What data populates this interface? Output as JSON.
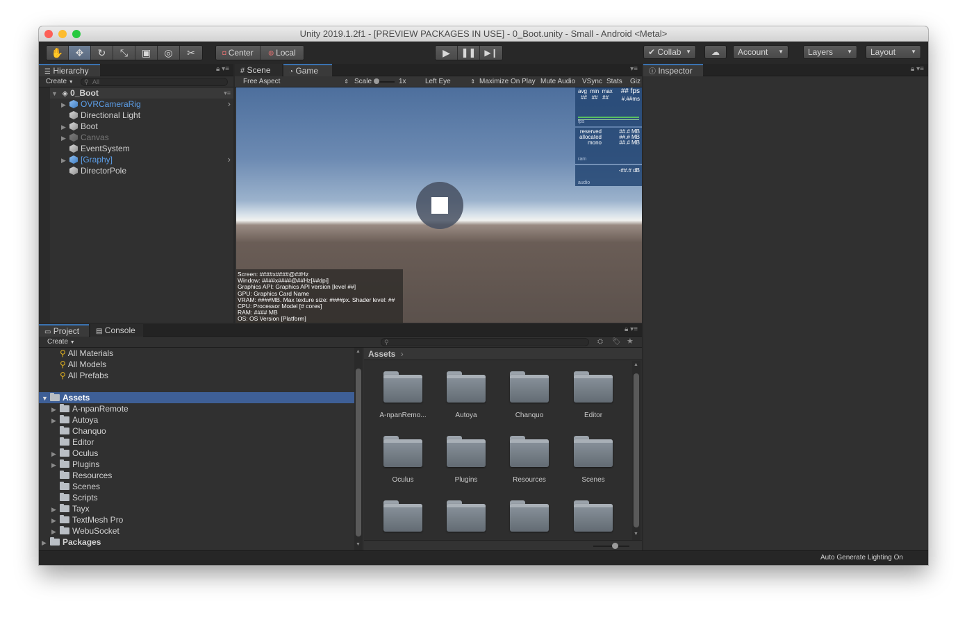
{
  "window": {
    "title": "Unity 2019.1.2f1 - [PREVIEW PACKAGES IN USE] - 0_Boot.unity - Small - Android <Metal>",
    "traffic_light_colors": [
      "#fd5f57",
      "#fdbc2e",
      "#28c940"
    ]
  },
  "toolbar": {
    "tools": [
      "hand-icon",
      "move-icon",
      "rotate-icon",
      "scale-icon",
      "rect-icon",
      "transform-icon",
      "custom-tool-icon"
    ],
    "pivot_label": "Center",
    "space_label": "Local",
    "collab_label": "Collab",
    "account_label": "Account",
    "layers_label": "Layers",
    "layout_label": "Layout"
  },
  "hierarchy": {
    "tab_label": "Hierarchy",
    "create_label": "Create",
    "search_placeholder": "All",
    "scene_name": "0_Boot",
    "items": [
      {
        "label": "OVRCameraRig",
        "style": "prefab",
        "expandable": true,
        "has_child_arrow": true
      },
      {
        "label": "Directional Light",
        "style": "normal",
        "expandable": false,
        "has_child_arrow": false
      },
      {
        "label": "Boot",
        "style": "normal",
        "expandable": true,
        "has_child_arrow": false
      },
      {
        "label": "Canvas",
        "style": "disabled",
        "expandable": true,
        "has_child_arrow": false
      },
      {
        "label": "EventSystem",
        "style": "normal",
        "expandable": false,
        "has_child_arrow": false
      },
      {
        "label": "[Graphy]",
        "style": "prefab",
        "expandable": true,
        "has_child_arrow": true
      },
      {
        "label": "DirectorPole",
        "style": "normal",
        "expandable": false,
        "has_child_arrow": false
      }
    ]
  },
  "scene_game": {
    "scene_tab_label": "Scene",
    "game_tab_label": "Game",
    "aspect_label": "Free Aspect",
    "scale_label": "Scale",
    "scale_value": "1x",
    "eye_label": "Left Eye",
    "maximize_label": "Maximize On Play",
    "mute_label": "Mute Audio",
    "vsync_label": "VSync",
    "stats_label": "Stats",
    "gizmos_label": "Giz",
    "fps_overlay": {
      "headers": "avg  min  max",
      "values": "##   ##   ##",
      "fps": "## fps",
      "ms": "#.##ms",
      "label": "fps"
    },
    "ram_overlay": {
      "rows": [
        {
          "name": "reserved",
          "value": "##.# MB"
        },
        {
          "name": "allocated",
          "value": "##.# MB"
        },
        {
          "name": "mono",
          "value": "##.# MB"
        }
      ],
      "label": "ram"
    },
    "audio_overlay": {
      "value": "-##.# dB",
      "label": "audio"
    },
    "device_info": [
      "Screen: ####x####@##Hz",
      "Window: ####x####@##Hz[##dpi]",
      "Graphics API: Graphics API version [level ##]",
      "GPU: Graphics Card Name",
      "VRAM: ####MB. Max texture size: ####px. Shader level: ##",
      "CPU: Processor Model [# cores]",
      "RAM: #### MB",
      "OS: OS Version [Platform]"
    ]
  },
  "inspector": {
    "tab_label": "Inspector"
  },
  "project": {
    "project_tab_label": "Project",
    "console_tab_label": "Console",
    "create_label": "Create",
    "favorites": [
      "All Materials",
      "All Models",
      "All Prefabs"
    ],
    "root_label": "Assets",
    "tree": [
      {
        "label": "A-npanRemote",
        "expandable": true
      },
      {
        "label": "Autoya",
        "expandable": true
      },
      {
        "label": "Chanquo",
        "expandable": false
      },
      {
        "label": "Editor",
        "expandable": false
      },
      {
        "label": "Oculus",
        "expandable": true
      },
      {
        "label": "Plugins",
        "expandable": true
      },
      {
        "label": "Resources",
        "expandable": false
      },
      {
        "label": "Scenes",
        "expandable": false
      },
      {
        "label": "Scripts",
        "expandable": false
      },
      {
        "label": "Tayx",
        "expandable": true
      },
      {
        "label": "TextMesh Pro",
        "expandable": true
      },
      {
        "label": "WebuSocket",
        "expandable": true
      }
    ],
    "packages_label": "Packages",
    "breadcrumb": "Assets",
    "grid": [
      "A-npanRemo...",
      "Autoya",
      "Chanquo",
      "Editor",
      "Oculus",
      "Plugins",
      "Resources",
      "Scenes",
      "",
      "",
      "",
      ""
    ]
  },
  "status": {
    "message": "Auto Generate Lighting On"
  },
  "colors": {
    "selection": "#3e5f96",
    "prefab_text": "#5c9ee8",
    "accent_tab": "#3a72b0"
  }
}
